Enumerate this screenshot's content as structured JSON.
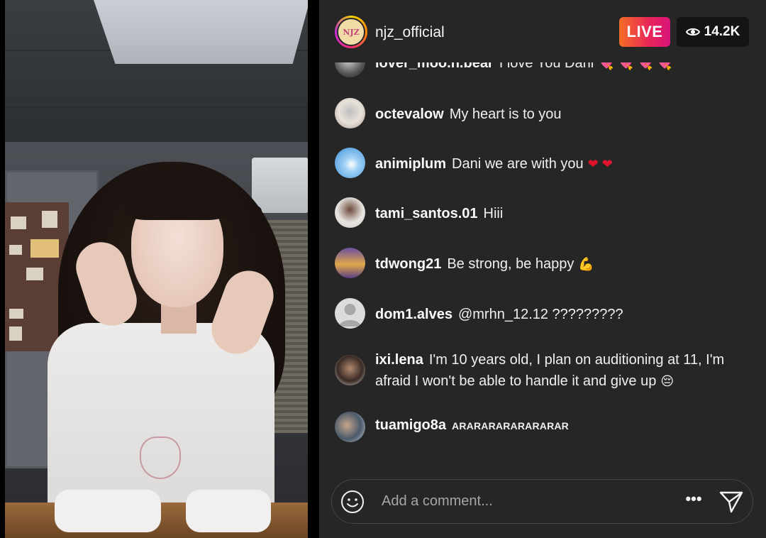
{
  "stream": {
    "host_username": "njz_official",
    "host_avatar_text": "NJZ",
    "live_label": "LIVE",
    "viewer_count": "14.2K"
  },
  "comments": [
    {
      "user": "lover_moo.n.bear",
      "text": "I love You Dani",
      "suffix": "💘 💘 💘 💘"
    },
    {
      "user": "octevalow",
      "text": "My heart is to you",
      "suffix": ""
    },
    {
      "user": "animiplum",
      "text": "Dani we are with you",
      "suffix": "❤ ❤"
    },
    {
      "user": "tami_santos.01",
      "text": "Hiii",
      "suffix": ""
    },
    {
      "user": "tdwong21",
      "text": "Be strong, be happy",
      "suffix": "💪"
    },
    {
      "user": "dom1.alves",
      "text": "@mrhn_12.12 ?????????",
      "suffix": ""
    },
    {
      "user": "ixi.lena",
      "text": "I'm 10 years old, I plan on auditioning at 11, I'm afraid I won't be able to handle it and give up",
      "suffix": "😔"
    },
    {
      "user": "tuamigo8a",
      "text": "ARARARARARARARAR",
      "suffix": ""
    }
  ],
  "composer": {
    "placeholder": "Add a comment...",
    "more_label": "•••"
  },
  "colors": {
    "panel_bg": "#262626",
    "live_gradient_start": "#f56d24",
    "live_gradient_end": "#d8157a",
    "heart": "#e0142c"
  },
  "icons": [
    "eye-icon",
    "smile-icon",
    "more-options-icon",
    "send-icon"
  ]
}
